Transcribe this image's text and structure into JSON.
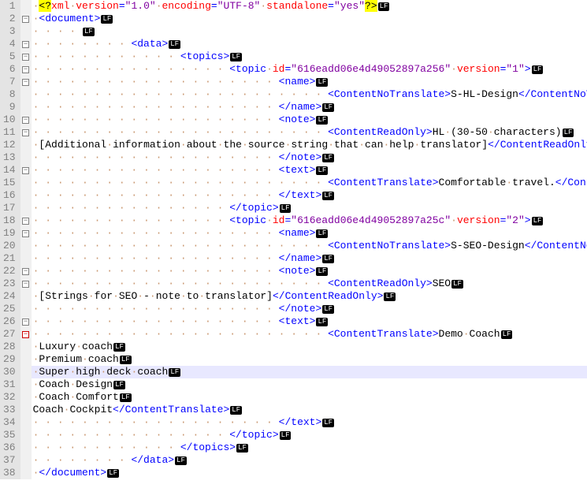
{
  "lf": "LF",
  "lines": [
    {
      "n": 1,
      "fold": "",
      "indent": 0,
      "current": false,
      "tokens": [
        [
          "pi-open",
          "<?"
        ],
        [
          "pi-body",
          "xml"
        ],
        [
          "ws",
          "·"
        ],
        [
          "attr",
          "version"
        ],
        [
          "tag",
          "="
        ],
        [
          "attrval",
          "\"1.0\""
        ],
        [
          "ws",
          "·"
        ],
        [
          "attr",
          "encoding"
        ],
        [
          "tag",
          "="
        ],
        [
          "attrval",
          "\"UTF-8\""
        ],
        [
          "ws",
          "·"
        ],
        [
          "attr",
          "standalone"
        ],
        [
          "tag",
          "="
        ],
        [
          "attrval",
          "\"yes\""
        ],
        [
          "pi-close",
          "?>"
        ]
      ]
    },
    {
      "n": 2,
      "fold": "box",
      "indent": 0,
      "current": false,
      "tokens": [
        [
          "tag",
          "<document>"
        ]
      ]
    },
    {
      "n": 3,
      "fold": "",
      "indent": 1,
      "current": false,
      "tokens": []
    },
    {
      "n": 4,
      "fold": "box",
      "indent": 2,
      "current": false,
      "tokens": [
        [
          "tag",
          "<data>"
        ]
      ]
    },
    {
      "n": 5,
      "fold": "box",
      "indent": 3,
      "current": false,
      "tokens": [
        [
          "tag",
          "<topics>"
        ]
      ]
    },
    {
      "n": 6,
      "fold": "box",
      "indent": 4,
      "current": false,
      "tokens": [
        [
          "tag",
          "<topic"
        ],
        [
          "ws",
          "·"
        ],
        [
          "attr",
          "id"
        ],
        [
          "tag",
          "="
        ],
        [
          "attrval",
          "\"616eadd06e4d49052897a256\""
        ],
        [
          "ws",
          "·"
        ],
        [
          "attr",
          "version"
        ],
        [
          "tag",
          "="
        ],
        [
          "attrval",
          "\"1\""
        ],
        [
          "tag",
          ">"
        ]
      ]
    },
    {
      "n": 7,
      "fold": "box",
      "indent": 5,
      "current": false,
      "tokens": [
        [
          "tag",
          "<name>"
        ]
      ]
    },
    {
      "n": 8,
      "fold": "",
      "indent": 6,
      "current": false,
      "tokens": [
        [
          "tag",
          "<ContentNoTranslate>"
        ],
        [
          "text",
          "S-HL-Design"
        ],
        [
          "tag",
          "</ContentNoTranslate>"
        ]
      ]
    },
    {
      "n": 9,
      "fold": "",
      "indent": 5,
      "current": false,
      "tokens": [
        [
          "tag",
          "</name>"
        ]
      ]
    },
    {
      "n": 10,
      "fold": "box",
      "indent": 5,
      "current": false,
      "tokens": [
        [
          "tag",
          "<note>"
        ]
      ]
    },
    {
      "n": 11,
      "fold": "box",
      "indent": 6,
      "current": false,
      "tokens": [
        [
          "tag",
          "<ContentReadOnly>"
        ],
        [
          "text",
          "HL"
        ],
        [
          "ws",
          "·"
        ],
        [
          "text",
          "(30-50"
        ],
        [
          "ws",
          "·"
        ],
        [
          "text",
          "characters)"
        ]
      ]
    },
    {
      "n": 12,
      "fold": "",
      "indent": 0,
      "current": false,
      "tokens": [
        [
          "text",
          "[Additional"
        ],
        [
          "ws",
          "·"
        ],
        [
          "text",
          "information"
        ],
        [
          "ws",
          "·"
        ],
        [
          "text",
          "about"
        ],
        [
          "ws",
          "·"
        ],
        [
          "text",
          "the"
        ],
        [
          "ws",
          "·"
        ],
        [
          "text",
          "source"
        ],
        [
          "ws",
          "·"
        ],
        [
          "text",
          "string"
        ],
        [
          "ws",
          "·"
        ],
        [
          "text",
          "that"
        ],
        [
          "ws",
          "·"
        ],
        [
          "text",
          "can"
        ],
        [
          "ws",
          "·"
        ],
        [
          "text",
          "help"
        ],
        [
          "ws",
          "·"
        ],
        [
          "text",
          "translator]"
        ],
        [
          "tag",
          "</ContentReadOnly>"
        ]
      ]
    },
    {
      "n": 13,
      "fold": "",
      "indent": 5,
      "current": false,
      "tokens": [
        [
          "tag",
          "</note>"
        ]
      ]
    },
    {
      "n": 14,
      "fold": "box",
      "indent": 5,
      "current": false,
      "tokens": [
        [
          "tag",
          "<text>"
        ]
      ]
    },
    {
      "n": 15,
      "fold": "",
      "indent": 6,
      "current": false,
      "tokens": [
        [
          "tag",
          "<ContentTranslate>"
        ],
        [
          "text",
          "Comfortable"
        ],
        [
          "ws",
          "·"
        ],
        [
          "text",
          "travel."
        ],
        [
          "tag",
          "</ContentTranslate>"
        ]
      ]
    },
    {
      "n": 16,
      "fold": "",
      "indent": 5,
      "current": false,
      "tokens": [
        [
          "tag",
          "</text>"
        ]
      ]
    },
    {
      "n": 17,
      "fold": "",
      "indent": 4,
      "current": false,
      "tokens": [
        [
          "tag",
          "</topic>"
        ]
      ]
    },
    {
      "n": 18,
      "fold": "box",
      "indent": 4,
      "current": false,
      "tokens": [
        [
          "tag",
          "<topic"
        ],
        [
          "ws",
          "·"
        ],
        [
          "attr",
          "id"
        ],
        [
          "tag",
          "="
        ],
        [
          "attrval",
          "\"616eadd06e4d49052897a25c\""
        ],
        [
          "ws",
          "·"
        ],
        [
          "attr",
          "version"
        ],
        [
          "tag",
          "="
        ],
        [
          "attrval",
          "\"2\""
        ],
        [
          "tag",
          ">"
        ]
      ]
    },
    {
      "n": 19,
      "fold": "box",
      "indent": 5,
      "current": false,
      "tokens": [
        [
          "tag",
          "<name>"
        ]
      ]
    },
    {
      "n": 20,
      "fold": "",
      "indent": 6,
      "current": false,
      "tokens": [
        [
          "tag",
          "<ContentNoTranslate>"
        ],
        [
          "text",
          "S-SEO-Design"
        ],
        [
          "tag",
          "</ContentNoTranslate>"
        ]
      ]
    },
    {
      "n": 21,
      "fold": "",
      "indent": 5,
      "current": false,
      "tokens": [
        [
          "tag",
          "</name>"
        ]
      ]
    },
    {
      "n": 22,
      "fold": "box",
      "indent": 5,
      "current": false,
      "tokens": [
        [
          "tag",
          "<note>"
        ]
      ]
    },
    {
      "n": 23,
      "fold": "box",
      "indent": 6,
      "current": false,
      "tokens": [
        [
          "tag",
          "<ContentReadOnly>"
        ],
        [
          "text",
          "SEO"
        ]
      ]
    },
    {
      "n": 24,
      "fold": "",
      "indent": 0,
      "current": false,
      "tokens": [
        [
          "text",
          "[Strings"
        ],
        [
          "ws",
          "·"
        ],
        [
          "text",
          "for"
        ],
        [
          "ws",
          "·"
        ],
        [
          "text",
          "SEO"
        ],
        [
          "ws",
          "·"
        ],
        [
          "text",
          "-"
        ],
        [
          "ws",
          "·"
        ],
        [
          "text",
          "note"
        ],
        [
          "ws",
          "·"
        ],
        [
          "text",
          "to"
        ],
        [
          "ws",
          "·"
        ],
        [
          "text",
          "translator]"
        ],
        [
          "tag",
          "</ContentReadOnly>"
        ]
      ]
    },
    {
      "n": 25,
      "fold": "",
      "indent": 5,
      "current": false,
      "tokens": [
        [
          "tag",
          "</note>"
        ]
      ]
    },
    {
      "n": 26,
      "fold": "box",
      "indent": 5,
      "current": false,
      "tokens": [
        [
          "tag",
          "<text>"
        ]
      ]
    },
    {
      "n": 27,
      "fold": "box-red",
      "indent": 6,
      "current": false,
      "tokens": [
        [
          "tag",
          "<ContentTranslate>"
        ],
        [
          "text",
          "Demo"
        ],
        [
          "ws",
          "·"
        ],
        [
          "text",
          "Coach"
        ]
      ]
    },
    {
      "n": 28,
      "fold": "",
      "indent": 0,
      "current": false,
      "tokens": [
        [
          "text",
          "Luxury"
        ],
        [
          "ws",
          "·"
        ],
        [
          "text",
          "coach"
        ]
      ]
    },
    {
      "n": 29,
      "fold": "",
      "indent": 0,
      "current": false,
      "tokens": [
        [
          "text",
          "Premium"
        ],
        [
          "ws",
          "·"
        ],
        [
          "text",
          "coach"
        ]
      ]
    },
    {
      "n": 30,
      "fold": "",
      "indent": 0,
      "current": true,
      "tokens": [
        [
          "text",
          "Super"
        ],
        [
          "ws",
          "·"
        ],
        [
          "text",
          "high"
        ],
        [
          "ws",
          "·"
        ],
        [
          "text",
          "deck"
        ],
        [
          "ws",
          "·"
        ],
        [
          "text",
          "coach"
        ]
      ]
    },
    {
      "n": 31,
      "fold": "",
      "indent": 0,
      "current": false,
      "tokens": [
        [
          "text",
          "Coach"
        ],
        [
          "ws",
          "·"
        ],
        [
          "text",
          "Design"
        ]
      ]
    },
    {
      "n": 32,
      "fold": "",
      "indent": 0,
      "current": false,
      "tokens": [
        [
          "text",
          "Coach"
        ],
        [
          "ws",
          "·"
        ],
        [
          "text",
          "Comfort"
        ]
      ]
    },
    {
      "n": 33,
      "fold": "",
      "indent": 0,
      "current": false,
      "noLeadDash": true,
      "tokens": [
        [
          "text",
          "Coach"
        ],
        [
          "ws",
          "·"
        ],
        [
          "text",
          "Cockpit"
        ],
        [
          "tag",
          "</ContentTranslate>"
        ]
      ]
    },
    {
      "n": 34,
      "fold": "",
      "indent": 5,
      "current": false,
      "tokens": [
        [
          "tag",
          "</text>"
        ]
      ]
    },
    {
      "n": 35,
      "fold": "",
      "indent": 4,
      "current": false,
      "tokens": [
        [
          "tag",
          "</topic>"
        ]
      ]
    },
    {
      "n": 36,
      "fold": "",
      "indent": 3,
      "current": false,
      "tokens": [
        [
          "tag",
          "</topics>"
        ]
      ]
    },
    {
      "n": 37,
      "fold": "",
      "indent": 2,
      "current": false,
      "tokens": [
        [
          "tag",
          "</data>"
        ]
      ]
    },
    {
      "n": 38,
      "fold": "",
      "indent": 0,
      "current": false,
      "tokens": [
        [
          "tag",
          "</document>"
        ]
      ]
    }
  ]
}
